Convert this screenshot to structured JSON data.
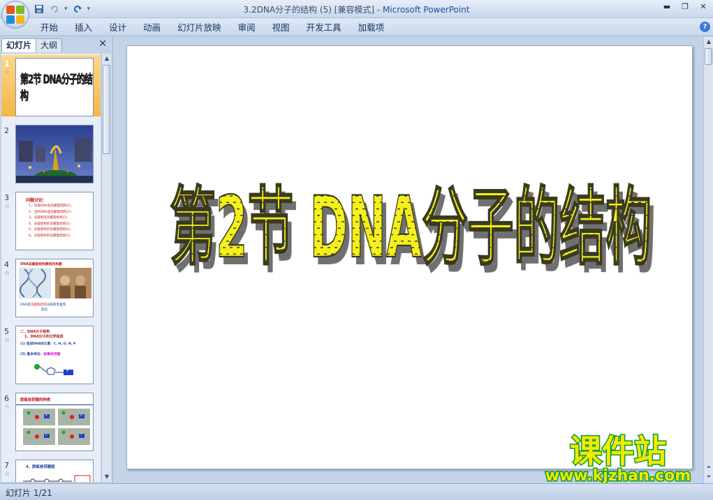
{
  "window": {
    "title_doc": "3.2DNA分子的结构 (5) [兼容模式] - ",
    "title_app": "Microsoft PowerPoint"
  },
  "ribbon": {
    "tabs": [
      "开始",
      "插入",
      "设计",
      "动画",
      "幻灯片放映",
      "审阅",
      "视图",
      "开发工具",
      "加载项"
    ]
  },
  "pane": {
    "tab_slides": "幻灯片",
    "tab_outline": "大纲"
  },
  "thumbnails": [
    {
      "num": "1",
      "title": "第2节 DNA分子的结构"
    },
    {
      "num": "2"
    },
    {
      "num": "3",
      "title": "问题讨论：",
      "lines": [
        "1、沃森DNA是双螺旋结构(1)",
        "2、当时DNA是双螺旋结构(1)",
        "3、沃森制造双螺旋结构(1)",
        "4、沃森结构的双螺旋结构(1)",
        "5、沃森结构的双螺旋结构(1)",
        "6、沃森结构的双螺旋结构(1)"
      ]
    },
    {
      "num": "4",
      "title": "DNA双螺旋结构模型的构建",
      "caption_a": "DNA是",
      "caption_b": "双螺旋结构",
      "caption_c": "沃森和克里克",
      "caption_d": "提出"
    },
    {
      "num": "5",
      "title": "二、DNA分子结构",
      "line1": "1、DNA分子的化学组成",
      "line2": "(1) 组成DNA的元素：C, H, O, N, P",
      "line3": "(2) 基本单位：",
      "line3b": "脱氧核苷酸",
      "box": "T"
    },
    {
      "num": "6",
      "title": "脱氧核苷酸的种类",
      "bases": [
        "A",
        "G",
        "C",
        "T"
      ]
    },
    {
      "num": "7",
      "title": "4、脱氧核苷酸链"
    }
  ],
  "slide": {
    "title": "第2节 DNA分子的结构",
    "watermark_big": "课件站",
    "watermark_url": "www.kjzhan.com"
  },
  "status": {
    "slide_counter": "幻灯片 1/21"
  },
  "colors": {
    "title_fill": "#f4f01a",
    "title_shadow": "#707070",
    "watermark_yellow": "#f2ea00",
    "watermark_green": "#0a9a33",
    "selected_thumb": "#f5b544"
  }
}
